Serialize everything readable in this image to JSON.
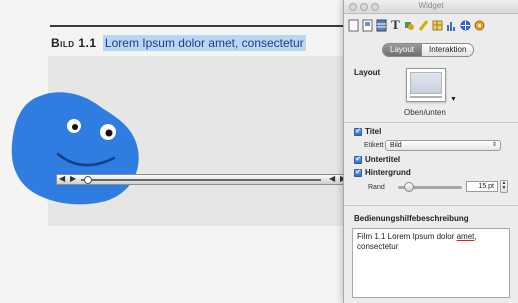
{
  "document": {
    "caption_label": "Bild 1.1",
    "caption_text": "Lorem Ipsum dolor amet, consectetur"
  },
  "movie_controller": {
    "volume_icon": "speaker-icon",
    "play_icon": "play-icon",
    "step_back_icon": "step-back-icon",
    "step_forward_icon": "step-forward-icon",
    "progress": 0.02
  },
  "inspector": {
    "window_title": "Widget",
    "toolbar_icons": [
      "document-icon",
      "layout-icon",
      "table-icon",
      "text-icon",
      "graphic-icon",
      "pen-icon",
      "table-grid-icon",
      "chart-icon",
      "link-icon",
      "media-icon"
    ],
    "tabs": [
      {
        "label": "Layout",
        "active": true
      },
      {
        "label": "Interaktion",
        "active": false
      }
    ],
    "layout_section_label": "Layout",
    "layout_name": "Oben/unten",
    "title_check": {
      "label": "Titel",
      "checked": true
    },
    "etikett_label": "Etikett",
    "etikett_value": "Bild",
    "subtitle_check": {
      "label": "Untertitel",
      "checked": true
    },
    "background_check": {
      "label": "Hintergrund",
      "checked": true
    },
    "rand_label": "Rand",
    "rand_value": "15 pt",
    "accessibility_label": "Bedienungshilfebeschreibung",
    "accessibility_text_before": "Film 1.1 Lorem Ipsum dolor ",
    "accessibility_text_underlined": "amet",
    "accessibility_text_after": ", consectetur"
  },
  "colors": {
    "caption_highlight": "#b8d7f6",
    "blob": "#2f7de0",
    "checkbox": "#2f6fc8"
  }
}
